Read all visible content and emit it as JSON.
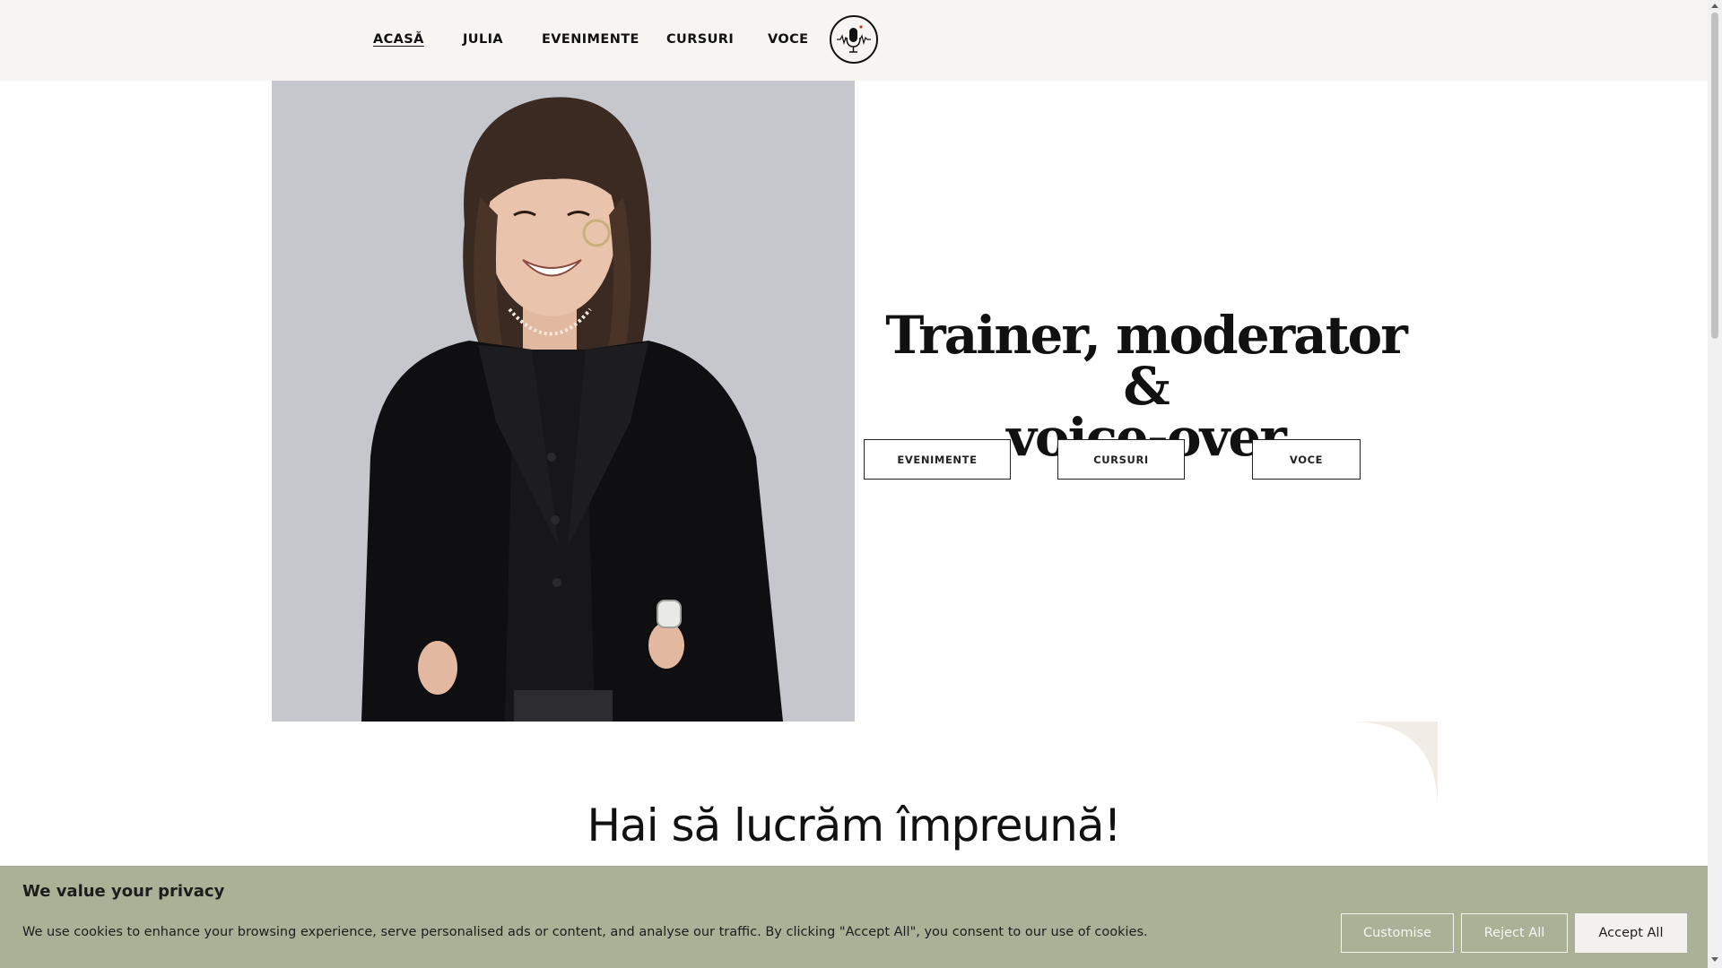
{
  "nav": {
    "items": [
      {
        "label": "ACASĂ",
        "active": true
      },
      {
        "label": "JULIA"
      },
      {
        "label": "EVENIMENTE"
      },
      {
        "label": "CURSURI"
      },
      {
        "label": "VOCE"
      }
    ],
    "logo_icon": "microphone-soundwave-icon"
  },
  "hero": {
    "title_line1": "Trainer, moderator &",
    "title_line2": "voice-over",
    "buttons": [
      "EVENIMENTE",
      "CURSURI",
      "VOCE"
    ]
  },
  "section": {
    "title": "Hai să lucrăm împreună!"
  },
  "cookie": {
    "title": "We value your privacy",
    "text": "We use cookies to enhance your browsing experience, serve personalised ads or content, and analyse our traffic. By clicking \"Accept All\", you consent to our use of cookies.",
    "customise": "Customise",
    "reject": "Reject All",
    "accept": "Accept All"
  },
  "colors": {
    "header_bg": "#f7f5f2",
    "cookie_bg": "#aab196",
    "photo_bg": "#c5c6cc"
  }
}
